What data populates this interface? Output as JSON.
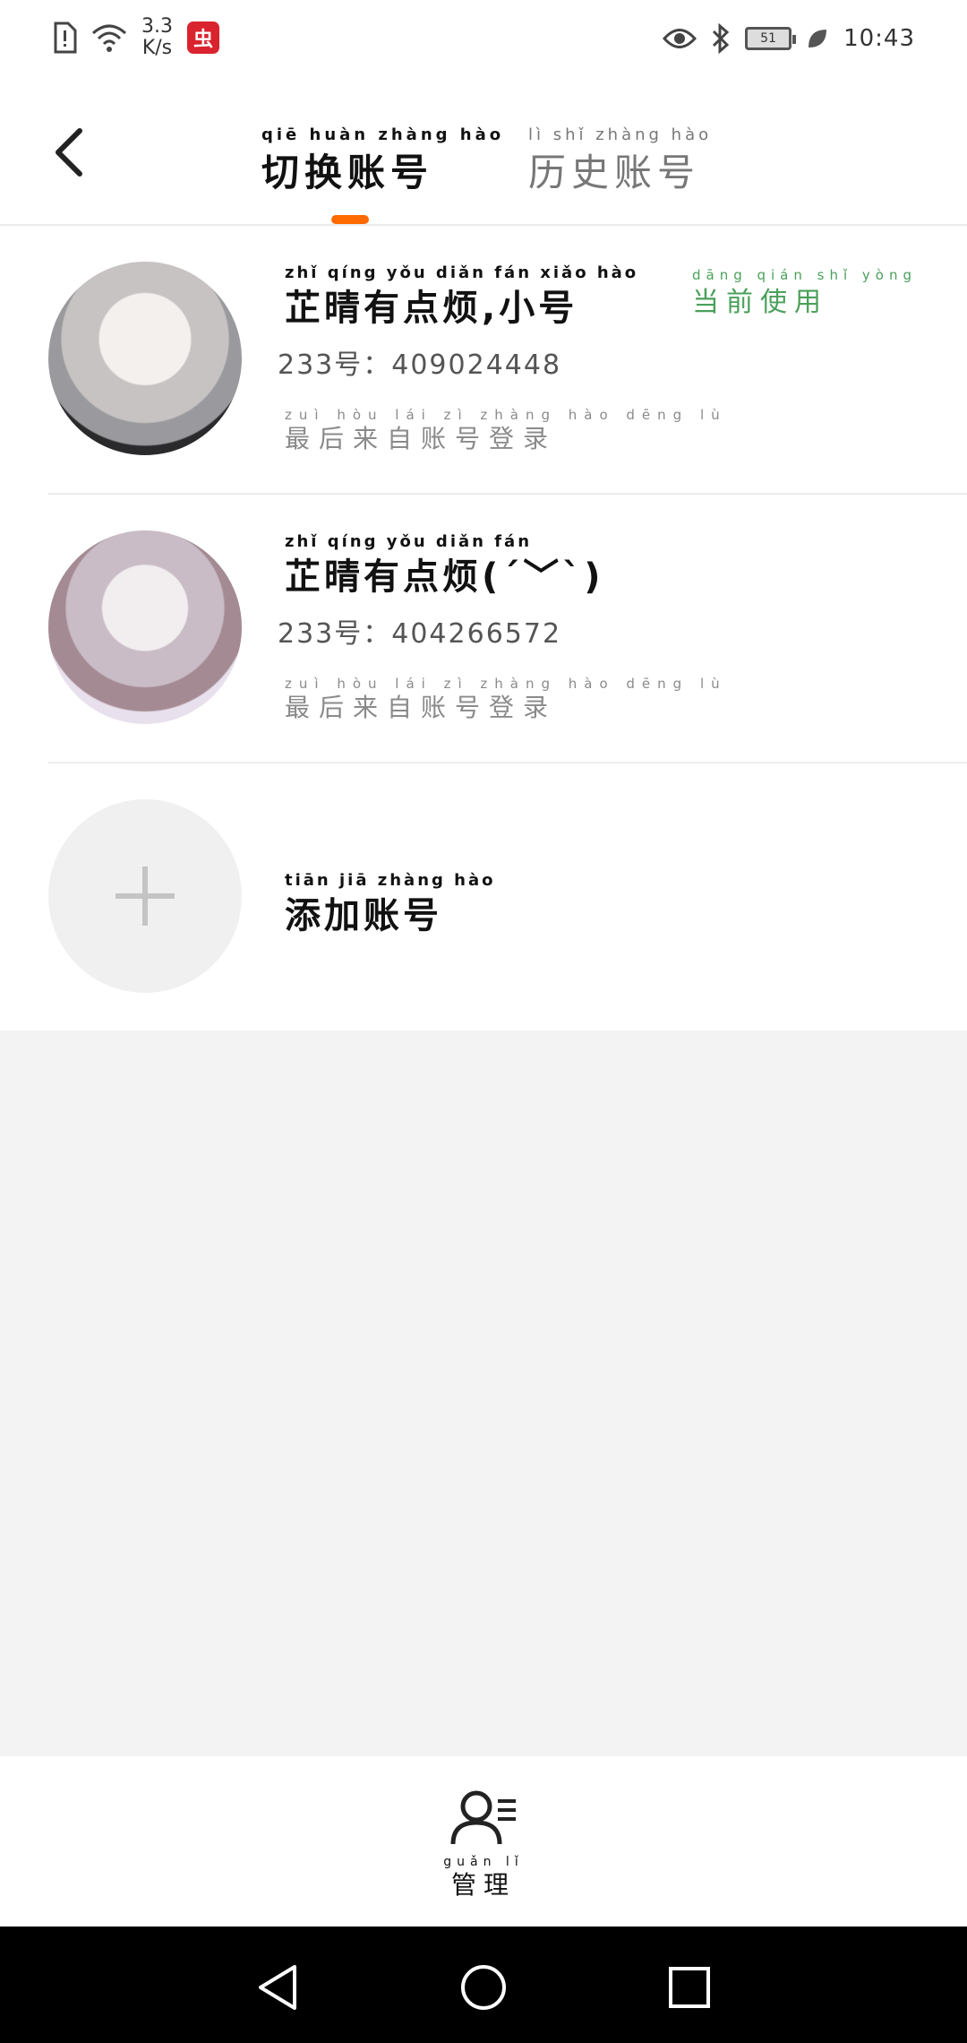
{
  "status_bar": {
    "net_speed_value": "3.3",
    "net_speed_unit": "K/s",
    "app_badge": "虫",
    "battery": "51",
    "time": "10:43"
  },
  "header": {
    "tabs": [
      {
        "label": "切换账号",
        "pinyin": "qiē huàn zhàng hào",
        "active": true
      },
      {
        "label": "历史账号",
        "pinyin": "lì shǐ zhàng hào",
        "active": false
      }
    ],
    "accent_color": "#ff6a00"
  },
  "accounts": [
    {
      "name": "芷晴有点烦,小号",
      "name_pinyin": "zhǐ qíng yǒu diǎn fán xiǎo hào",
      "uid": "233号：409024448",
      "last_login": "最后来自账号登录",
      "last_login_pinyin": "zuì hòu lái zì zhàng hào dēng lù",
      "current_label": "当前使用",
      "current_pinyin": "dāng qián shǐ yòng"
    },
    {
      "name": "芷晴有点烦(ˊ﹀ˋ)",
      "name_pinyin": "zhǐ qíng yǒu diǎn fán",
      "uid": "233号：404266572",
      "last_login": "最后来自账号登录",
      "last_login_pinyin": "zuì hòu lái zì zhàng hào dēng lù"
    }
  ],
  "add_account": {
    "label": "添加账号",
    "pinyin": "tiān jiā zhàng hào"
  },
  "bottom": {
    "manage_label": "管理",
    "manage_pinyin": "guǎn lǐ"
  }
}
